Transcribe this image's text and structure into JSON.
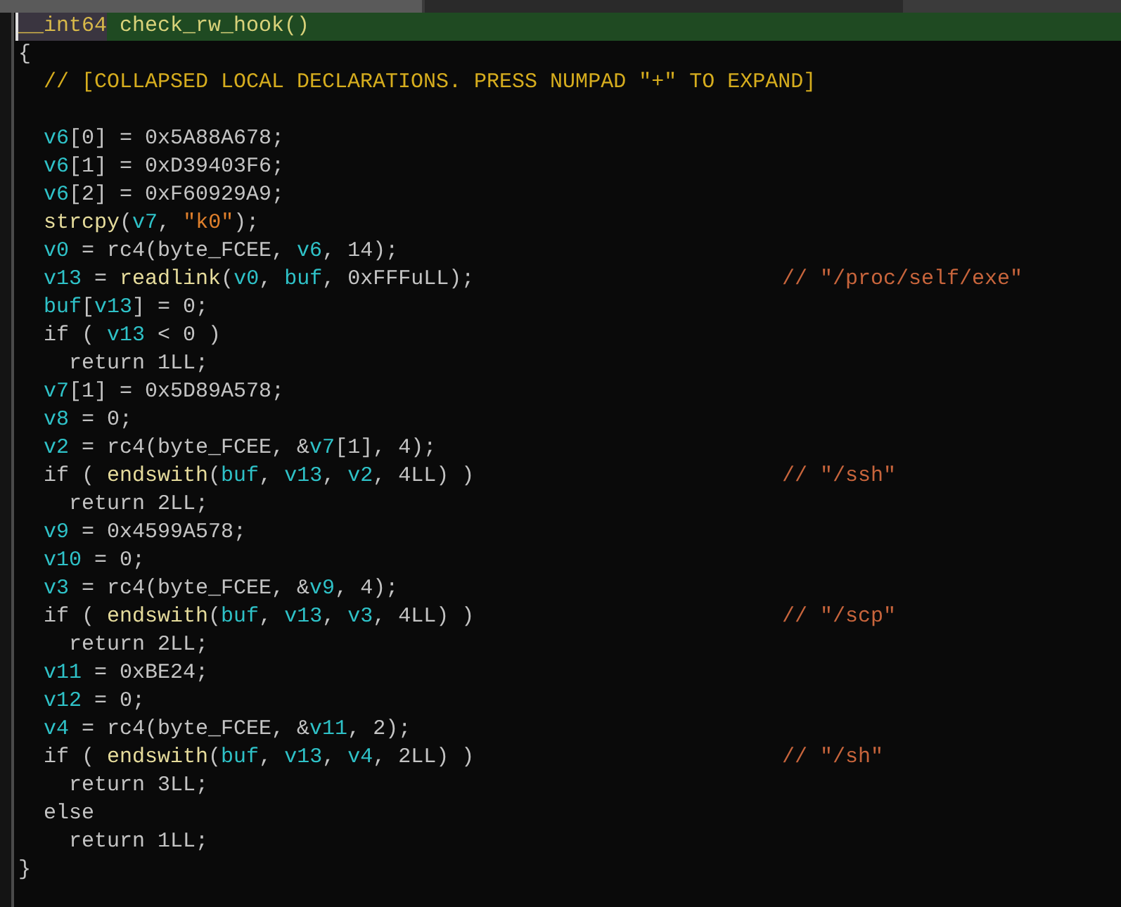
{
  "header": {
    "type": "__int64",
    "name": "check_rw_hook()"
  },
  "open_brace": "{",
  "body": [
    {
      "tokens": [
        {
          "kind": "collapsed",
          "text": "// [COLLAPSED LOCAL DECLARATIONS. PRESS NUMPAD \"+\" TO EXPAND]"
        }
      ]
    },
    {
      "tokens": [
        {
          "kind": "var",
          "text": "v6"
        },
        {
          "kind": "plain",
          "text": "[0] = 0x5A88A678;"
        }
      ]
    },
    {
      "tokens": [
        {
          "kind": "var",
          "text": "v6"
        },
        {
          "kind": "plain",
          "text": "[1] = 0xD39403F6;"
        }
      ]
    },
    {
      "tokens": [
        {
          "kind": "var",
          "text": "v6"
        },
        {
          "kind": "plain",
          "text": "[2] = 0xF60929A9;"
        }
      ]
    },
    {
      "tokens": [
        {
          "kind": "func",
          "text": "strcpy"
        },
        {
          "kind": "plain",
          "text": "("
        },
        {
          "kind": "var",
          "text": "v7"
        },
        {
          "kind": "plain",
          "text": ", "
        },
        {
          "kind": "str",
          "text": "\"k0\""
        },
        {
          "kind": "plain",
          "text": ");"
        }
      ]
    },
    {
      "tokens": [
        {
          "kind": "var",
          "text": "v0"
        },
        {
          "kind": "plain",
          "text": " = rc4(byte_FCEE, "
        },
        {
          "kind": "var",
          "text": "v6"
        },
        {
          "kind": "plain",
          "text": ", 14);"
        }
      ]
    },
    {
      "tokens": [
        {
          "kind": "var",
          "text": "v13"
        },
        {
          "kind": "plain",
          "text": " = "
        },
        {
          "kind": "func",
          "text": "readlink"
        },
        {
          "kind": "plain",
          "text": "("
        },
        {
          "kind": "var",
          "text": "v0"
        },
        {
          "kind": "plain",
          "text": ", "
        },
        {
          "kind": "var",
          "text": "buf"
        },
        {
          "kind": "plain",
          "text": ", 0xFFFuLL);"
        },
        {
          "kind": "comment",
          "text": "// \"/proc/self/exe\""
        }
      ]
    },
    {
      "tokens": [
        {
          "kind": "var",
          "text": "buf"
        },
        {
          "kind": "plain",
          "text": "["
        },
        {
          "kind": "var",
          "text": "v13"
        },
        {
          "kind": "plain",
          "text": "] = 0;"
        }
      ]
    },
    {
      "tokens": [
        {
          "kind": "plain",
          "text": "if ( "
        },
        {
          "kind": "var",
          "text": "v13"
        },
        {
          "kind": "plain",
          "text": " < 0 )"
        }
      ],
      "children": [
        {
          "tokens": [
            {
              "kind": "plain",
              "text": "return 1LL;"
            }
          ]
        }
      ]
    },
    {
      "tokens": [
        {
          "kind": "var",
          "text": "v7"
        },
        {
          "kind": "plain",
          "text": "[1] = 0x5D89A578;"
        }
      ]
    },
    {
      "tokens": [
        {
          "kind": "var",
          "text": "v8"
        },
        {
          "kind": "plain",
          "text": " = 0;"
        }
      ]
    },
    {
      "tokens": [
        {
          "kind": "var",
          "text": "v2"
        },
        {
          "kind": "plain",
          "text": " = rc4(byte_FCEE, &"
        },
        {
          "kind": "var",
          "text": "v7"
        },
        {
          "kind": "plain",
          "text": "[1], 4);"
        }
      ]
    },
    {
      "tokens": [
        {
          "kind": "plain",
          "text": "if ( "
        },
        {
          "kind": "func",
          "text": "endswith"
        },
        {
          "kind": "plain",
          "text": "("
        },
        {
          "kind": "var",
          "text": "buf"
        },
        {
          "kind": "plain",
          "text": ", "
        },
        {
          "kind": "var",
          "text": "v13"
        },
        {
          "kind": "plain",
          "text": ", "
        },
        {
          "kind": "var",
          "text": "v2"
        },
        {
          "kind": "plain",
          "text": ", 4LL) )"
        },
        {
          "kind": "comment",
          "text": "// \"/ssh\""
        }
      ],
      "children": [
        {
          "tokens": [
            {
              "kind": "plain",
              "text": "return 2LL;"
            }
          ]
        }
      ]
    },
    {
      "tokens": [
        {
          "kind": "var",
          "text": "v9"
        },
        {
          "kind": "plain",
          "text": " = 0x4599A578;"
        }
      ]
    },
    {
      "tokens": [
        {
          "kind": "var",
          "text": "v10"
        },
        {
          "kind": "plain",
          "text": " = 0;"
        }
      ]
    },
    {
      "tokens": [
        {
          "kind": "var",
          "text": "v3"
        },
        {
          "kind": "plain",
          "text": " = rc4(byte_FCEE, &"
        },
        {
          "kind": "var",
          "text": "v9"
        },
        {
          "kind": "plain",
          "text": ", 4);"
        }
      ]
    },
    {
      "tokens": [
        {
          "kind": "plain",
          "text": "if ( "
        },
        {
          "kind": "func",
          "text": "endswith"
        },
        {
          "kind": "plain",
          "text": "("
        },
        {
          "kind": "var",
          "text": "buf"
        },
        {
          "kind": "plain",
          "text": ", "
        },
        {
          "kind": "var",
          "text": "v13"
        },
        {
          "kind": "plain",
          "text": ", "
        },
        {
          "kind": "var",
          "text": "v3"
        },
        {
          "kind": "plain",
          "text": ", 4LL) )"
        },
        {
          "kind": "comment",
          "text": "// \"/scp\""
        }
      ],
      "children": [
        {
          "tokens": [
            {
              "kind": "plain",
              "text": "return 2LL;"
            }
          ]
        }
      ]
    },
    {
      "tokens": [
        {
          "kind": "var",
          "text": "v11"
        },
        {
          "kind": "plain",
          "text": " = 0xBE24;"
        }
      ]
    },
    {
      "tokens": [
        {
          "kind": "var",
          "text": "v12"
        },
        {
          "kind": "plain",
          "text": " = 0;"
        }
      ]
    },
    {
      "tokens": [
        {
          "kind": "var",
          "text": "v4"
        },
        {
          "kind": "plain",
          "text": " = rc4(byte_FCEE, &"
        },
        {
          "kind": "var",
          "text": "v11"
        },
        {
          "kind": "plain",
          "text": ", 2);"
        }
      ]
    },
    {
      "tokens": [
        {
          "kind": "plain",
          "text": "if ( "
        },
        {
          "kind": "func",
          "text": "endswith"
        },
        {
          "kind": "plain",
          "text": "("
        },
        {
          "kind": "var",
          "text": "buf"
        },
        {
          "kind": "plain",
          "text": ", "
        },
        {
          "kind": "var",
          "text": "v13"
        },
        {
          "kind": "plain",
          "text": ", "
        },
        {
          "kind": "var",
          "text": "v4"
        },
        {
          "kind": "plain",
          "text": ", 2LL) )"
        },
        {
          "kind": "comment",
          "text": "// \"/sh\""
        }
      ],
      "children": [
        {
          "tokens": [
            {
              "kind": "plain",
              "text": "return 3LL;"
            }
          ]
        }
      ]
    },
    {
      "tokens": [
        {
          "kind": "plain",
          "text": "else"
        }
      ],
      "children": [
        {
          "tokens": [
            {
              "kind": "plain",
              "text": "return 1LL;"
            }
          ]
        }
      ]
    }
  ],
  "close_brace": "}"
}
